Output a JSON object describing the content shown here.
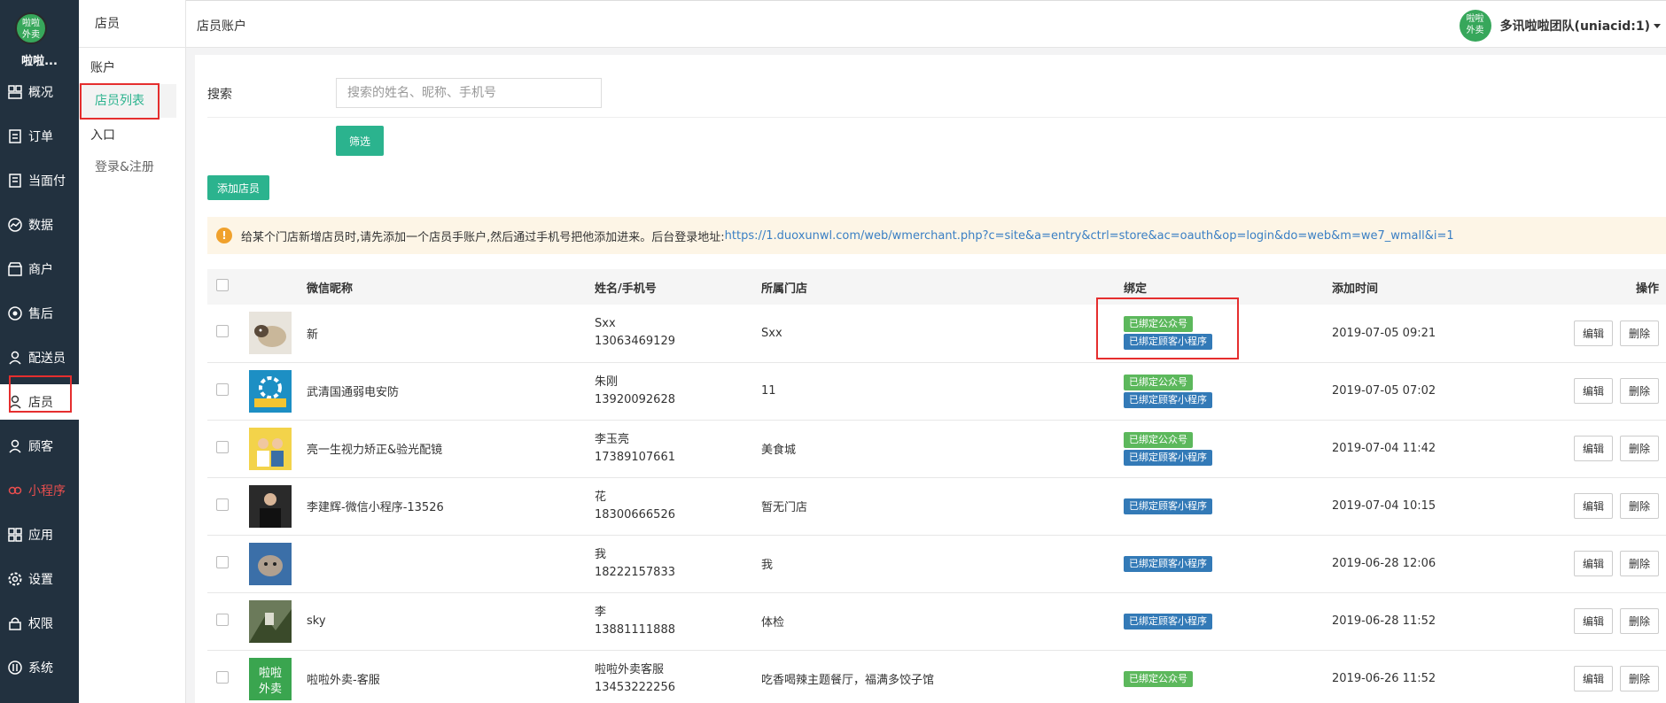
{
  "brand": {
    "logo_text": "啦啦\n外卖",
    "name": "啦啦..."
  },
  "nav": [
    {
      "label": "概况",
      "icon": "dashboard-icon"
    },
    {
      "label": "订单",
      "icon": "order-icon"
    },
    {
      "label": "当面付",
      "icon": "pay-icon"
    },
    {
      "label": "数据",
      "icon": "chart-icon"
    },
    {
      "label": "商户",
      "icon": "store-icon"
    },
    {
      "label": "售后",
      "icon": "aftersale-icon"
    },
    {
      "label": "配送员",
      "icon": "user-icon"
    },
    {
      "label": "店员",
      "icon": "user-icon"
    },
    {
      "label": "顾客",
      "icon": "user-icon"
    },
    {
      "label": "小程序",
      "icon": "miniapp-icon"
    },
    {
      "label": "应用",
      "icon": "apps-icon"
    },
    {
      "label": "设置",
      "icon": "gear-icon"
    },
    {
      "label": "权限",
      "icon": "lock-icon"
    },
    {
      "label": "系统",
      "icon": "system-icon"
    }
  ],
  "submenu": {
    "title": "店员",
    "group1": "账户",
    "link_list": "店员列表",
    "group2": "入口",
    "link_login": "登录&注册"
  },
  "topbar": {
    "breadcrumb": "店员账户",
    "user_logo": "啦啦\n外卖",
    "user_name": "多讯啦啦团队(uniacid:1)"
  },
  "filter": {
    "search_label": "搜索",
    "search_placeholder": "搜索的姓名、昵称、手机号",
    "filter_button": "筛选",
    "add_button": "添加店员"
  },
  "notice": {
    "icon": "info-icon",
    "text": "给某个门店新增店员时,请先添加一个店员手账户,然后通过手机号把他添加进来。后台登录地址:",
    "link": "https://1.duoxunwl.com/web/wmerchant.php?c=site&a=entry&ctrl=store&ac=oauth&op=login&do=web&m=we7_wmall&i=1"
  },
  "table": {
    "headers": {
      "nickname": "微信昵称",
      "name_phone": "姓名/手机号",
      "store": "所属门店",
      "bind": "绑定",
      "time": "添加时间",
      "ops": "操作"
    },
    "tag_mp": "已绑定公众号",
    "tag_mini": "已绑定顾客小程序",
    "edit": "编辑",
    "delete": "删除",
    "rows": [
      {
        "nickname": "新",
        "name": "Sxx",
        "phone": "13063469129",
        "store": "Sxx",
        "mp": true,
        "mini": true,
        "time": "2019-07-05 09:21",
        "avatar": "cat"
      },
      {
        "nickname": "武清国通弱电安防",
        "name": "朱刚",
        "phone": "13920092628",
        "store": "11",
        "mp": true,
        "mini": true,
        "time": "2019-07-05 07:02",
        "avatar": "gear"
      },
      {
        "nickname": "亮一生视力矫正&验光配镜",
        "name": "李玉亮",
        "phone": "17389107661",
        "store": "美食城",
        "mp": true,
        "mini": true,
        "time": "2019-07-04 11:42",
        "avatar": "family"
      },
      {
        "nickname": "李建辉-微信小程序-13526",
        "name": "花",
        "phone": "18300666526",
        "store": "暂无门店",
        "mp": false,
        "mini": true,
        "time": "2019-07-04 10:15",
        "avatar": "man"
      },
      {
        "nickname": "",
        "name": "我",
        "phone": "18222157833",
        "store": "我",
        "mp": false,
        "mini": true,
        "time": "2019-06-28 12:06",
        "avatar": "kitten"
      },
      {
        "nickname": "sky",
        "name": "李",
        "phone": "13881111888",
        "store": "体检",
        "mp": false,
        "mini": true,
        "time": "2019-06-28 11:52",
        "avatar": "landscape"
      },
      {
        "nickname": "啦啦外卖-客服",
        "name": "啦啦外卖客服",
        "phone": "13453222256",
        "store": "吃香喝辣主题餐厅，福满多饺子馆",
        "mp": true,
        "mini": false,
        "time": "2019-06-26 11:52",
        "avatar": "brand"
      }
    ]
  },
  "colors": {
    "sidebar": "#22313f",
    "accent": "#2bb38e",
    "tag_green": "#5cb85c",
    "tag_blue": "#337ab7",
    "highlight_box": "#e52e2e"
  }
}
